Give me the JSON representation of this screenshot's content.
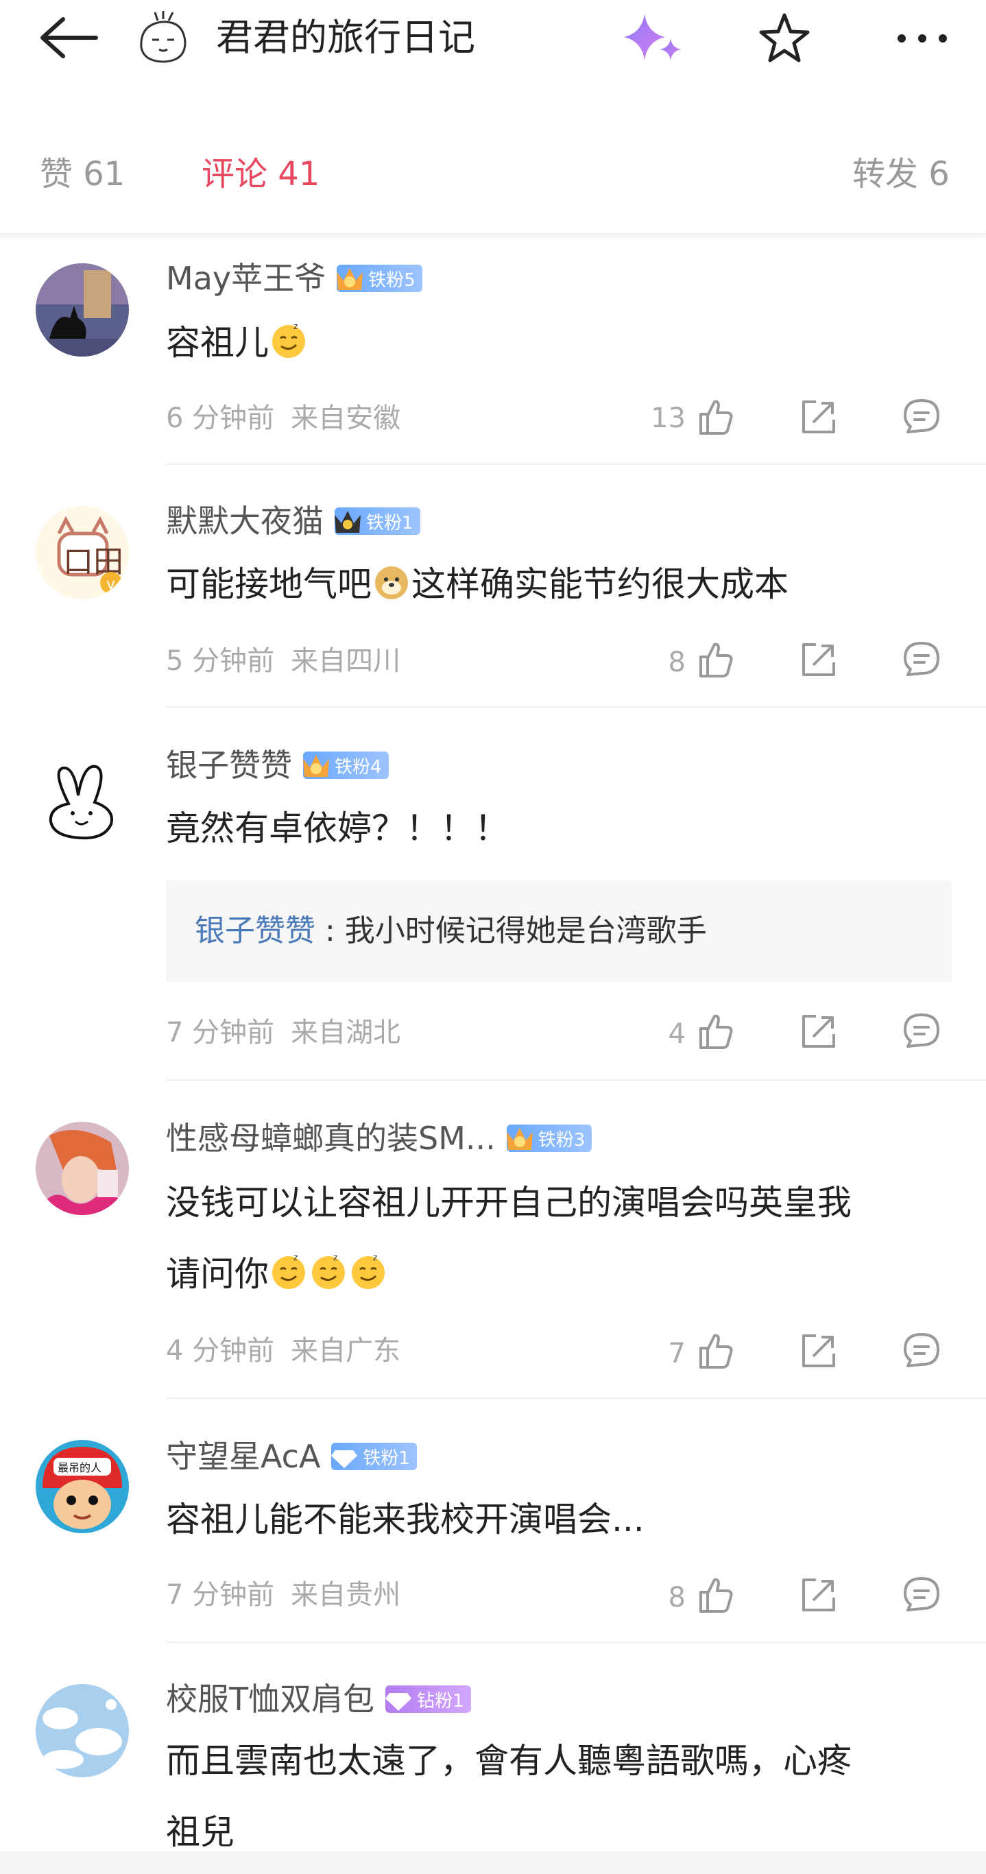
{
  "header": {
    "title": "君君的旅行日记",
    "icons": [
      "back-arrow-icon",
      "profile-avatar",
      "sparkle-icon",
      "star-icon",
      "more-icon"
    ]
  },
  "tabs": [
    {
      "label": "赞 61",
      "active": false
    },
    {
      "label": "评论 41",
      "active": true
    },
    {
      "label": "转发 6",
      "active": false
    }
  ],
  "accent_color": "#e8485e",
  "comments": [
    {
      "username": "May苹王爷",
      "badge": "铁粉5",
      "text": "容祖儿",
      "emoji_count": 1,
      "time": "6 分钟前",
      "location": "来自安徽",
      "likes": "13"
    },
    {
      "username": "默默大夜猫",
      "badge": "铁粉1",
      "text_before": "可能接地气吧",
      "text_after": "这样确实能节约很大成本",
      "time": "5 分钟前",
      "location": "来自四川",
      "likes": "8"
    },
    {
      "username": "银子赞赞",
      "badge": "铁粉4",
      "text": "竟然有卓依婷？！！！",
      "reply": {
        "name": "银子赞赞",
        "text": " : 我小时候记得她是台湾歌手"
      },
      "time": "7 分钟前",
      "location": "来自湖北",
      "likes": "4"
    },
    {
      "username": "性感母蟑螂真的装SM...",
      "badge": "铁粉3",
      "text_line1": "没钱可以让容祖儿开开自己的演唱会吗英皇我",
      "text_line2": "请问你",
      "emoji_count": 3,
      "time": "4 分钟前",
      "location": "来自广东",
      "likes": "7"
    },
    {
      "username": "守望星AcA",
      "badge": "铁粉1",
      "text": "容祖儿能不能来我校开演唱会...",
      "time": "7 分钟前",
      "location": "来自贵州",
      "likes": "8"
    },
    {
      "username": "校服T恤双肩包",
      "badge": "钻粉1",
      "text_line1": "而且雲南也太遠了，會有人聽粵語歌嗎，心疼",
      "text_line2": "祖兒"
    }
  ]
}
